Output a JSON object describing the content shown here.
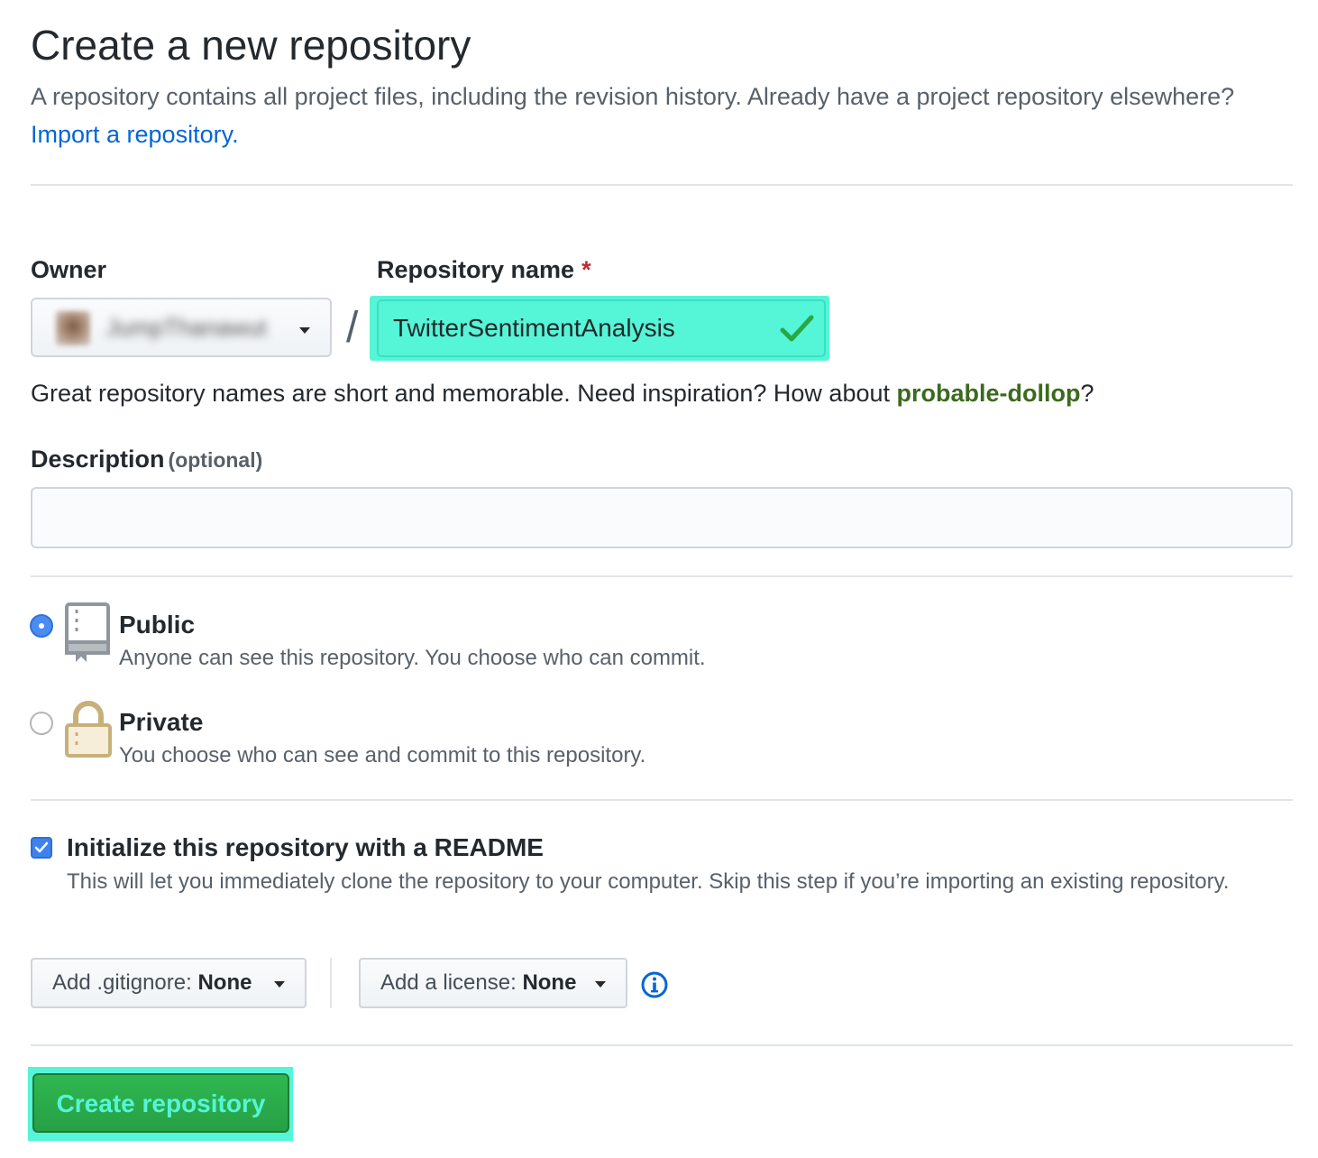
{
  "header": {
    "title": "Create a new repository",
    "subtitle": "A repository contains all project files, including the revision history. Already have a project repository elsewhere?",
    "import_link": "Import a repository."
  },
  "owner": {
    "label": "Owner",
    "selected": "JumpThanawut"
  },
  "repo_name": {
    "label": "Repository name",
    "required_mark": "*",
    "value": "TwitterSentimentAnalysis",
    "separator": "/"
  },
  "hint": {
    "text": "Great repository names are short and memorable. Need inspiration? How about",
    "suggestion": "probable-dollop",
    "suffix": "?"
  },
  "description": {
    "label": "Description",
    "optional": "(optional)",
    "value": ""
  },
  "visibility": {
    "options": [
      {
        "title": "Public",
        "desc": "Anyone can see this repository. You choose who can commit.",
        "selected": true
      },
      {
        "title": "Private",
        "desc": "You choose who can see and commit to this repository.",
        "selected": false
      }
    ]
  },
  "readme": {
    "label": "Initialize this repository with a README",
    "desc": "This will let you immediately clone the repository to your computer. Skip this step if you’re importing an existing repository.",
    "checked": true
  },
  "gitignore": {
    "prefix": "Add .gitignore:",
    "value": "None"
  },
  "license": {
    "prefix": "Add a license:",
    "value": "None"
  },
  "submit": {
    "label": "Create repository"
  },
  "colors": {
    "highlight": "#55f5d7",
    "button_green": "#28a745",
    "link_blue": "#0366d6",
    "suggestion_green": "#3b6a1e"
  }
}
